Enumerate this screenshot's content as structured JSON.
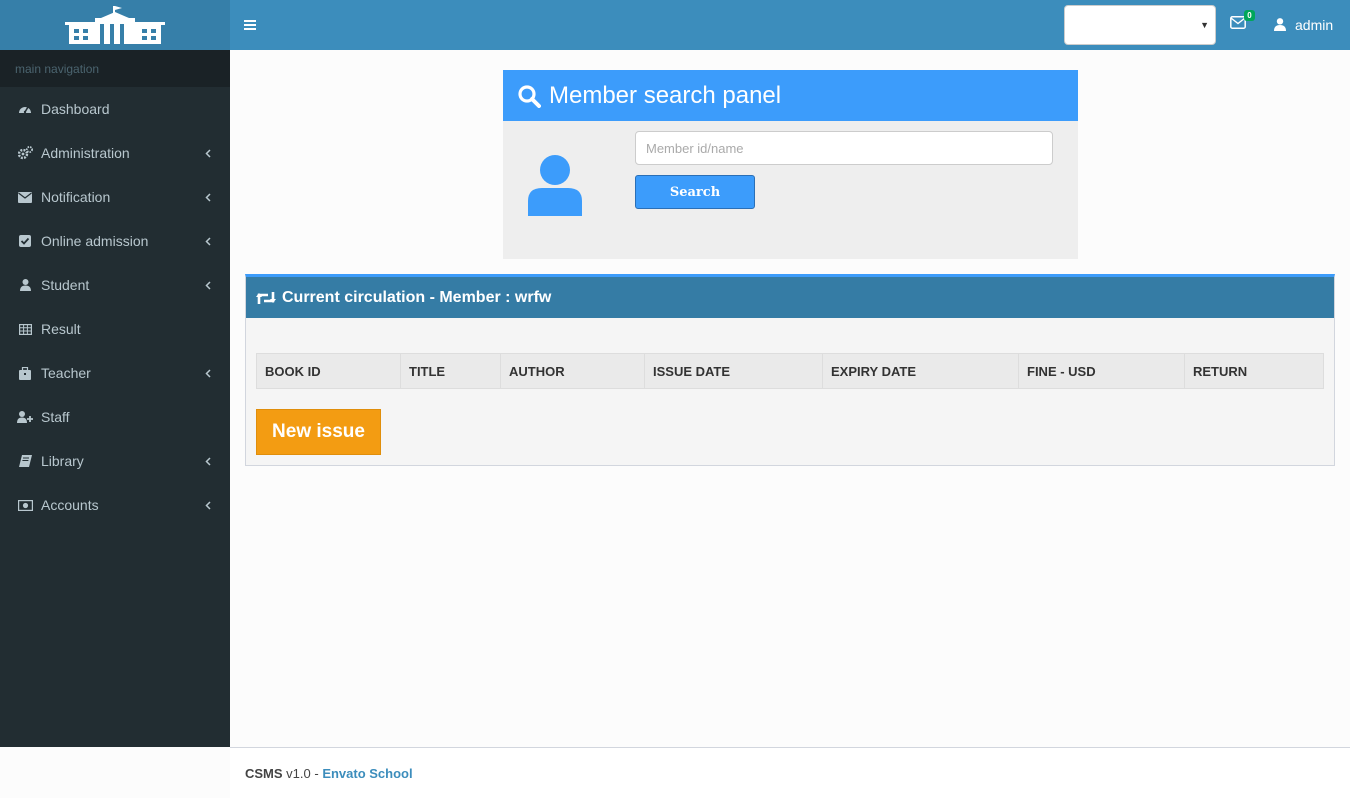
{
  "sidebar": {
    "header": "main navigation",
    "items": [
      {
        "label": "Dashboard",
        "icon": "dashboard-icon",
        "expandable": false
      },
      {
        "label": "Administration",
        "icon": "cogs-icon",
        "expandable": true
      },
      {
        "label": "Notification",
        "icon": "envelope-icon",
        "expandable": true
      },
      {
        "label": "Online admission",
        "icon": "check-square-icon",
        "expandable": true
      },
      {
        "label": "Student",
        "icon": "user-icon",
        "expandable": true
      },
      {
        "label": "Result",
        "icon": "table-icon",
        "expandable": false
      },
      {
        "label": "Teacher",
        "icon": "briefcase-icon",
        "expandable": true
      },
      {
        "label": "Staff",
        "icon": "user-plus-icon",
        "expandable": false
      },
      {
        "label": "Library",
        "icon": "book-icon",
        "expandable": true
      },
      {
        "label": "Accounts",
        "icon": "money-icon",
        "expandable": true
      }
    ]
  },
  "navbar": {
    "select_value": "",
    "mail_count": "0",
    "username": "admin"
  },
  "search_panel": {
    "title": "Member search panel",
    "input_value": "",
    "input_placeholder": "Member id/name",
    "button_label": "Search"
  },
  "circulation": {
    "title": "Current circulation - Member : wrfw",
    "columns": [
      "BOOK ID",
      "TITLE",
      "AUTHOR",
      "ISSUE DATE",
      "EXPIRY DATE",
      "FINE - USD",
      "RETURN"
    ],
    "rows": [],
    "new_issue_label": "New issue"
  },
  "footer": {
    "app": "CSMS",
    "version": " v1.0 - ",
    "link": "Envato School"
  },
  "colors": {
    "navbar": "#3c8dbc",
    "logo_bg": "#367fa9",
    "sidebar": "#222d32",
    "panel_header": "#3c9cfb",
    "box_header": "#357ca5",
    "new_issue": "#f39c12"
  }
}
